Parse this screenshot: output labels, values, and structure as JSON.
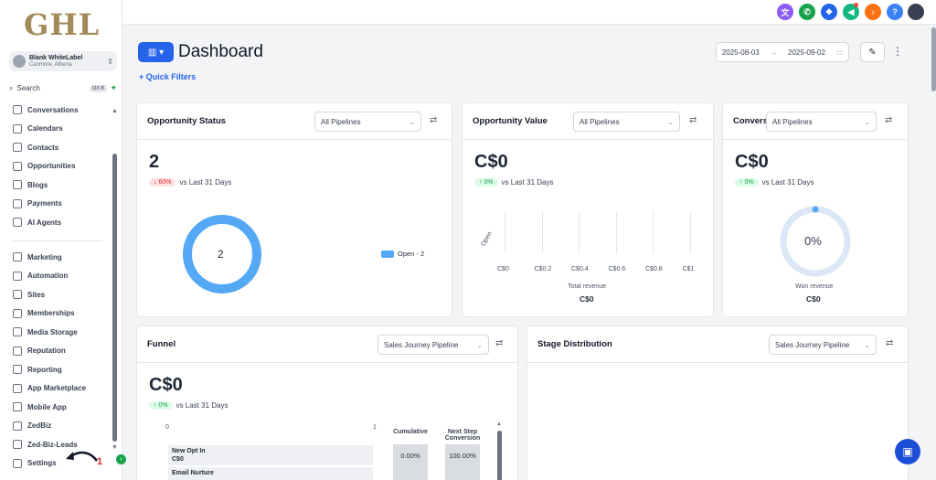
{
  "brand": {
    "logo_text": "GHL"
  },
  "account": {
    "name": "Blank WhiteLabel",
    "location": "Canmore, Alberta"
  },
  "search": {
    "label": "Search",
    "shortcut": "ctrl K"
  },
  "sidebar": {
    "group1": [
      {
        "label": "Conversations",
        "icon": "chat-icon"
      },
      {
        "label": "Calendars",
        "icon": "calendar-icon"
      },
      {
        "label": "Contacts",
        "icon": "contacts-icon"
      },
      {
        "label": "Opportunities",
        "icon": "opportunities-icon"
      },
      {
        "label": "Blogs",
        "icon": "blog-icon"
      },
      {
        "label": "Payments",
        "icon": "payments-icon"
      },
      {
        "label": "AI Agents",
        "icon": "ai-icon"
      }
    ],
    "group2": [
      {
        "label": "Marketing",
        "icon": "send-icon"
      },
      {
        "label": "Automation",
        "icon": "automation-icon"
      },
      {
        "label": "Sites",
        "icon": "sites-icon"
      },
      {
        "label": "Memberships",
        "icon": "memberships-icon"
      },
      {
        "label": "Media Storage",
        "icon": "media-icon"
      },
      {
        "label": "Reputation",
        "icon": "star-icon"
      },
      {
        "label": "Reporting",
        "icon": "reporting-icon"
      },
      {
        "label": "App Marketplace",
        "icon": "apps-icon"
      },
      {
        "label": "Mobile App",
        "icon": "mobile-icon"
      },
      {
        "label": "ZedBiz",
        "icon": "zedbiz-icon"
      },
      {
        "label": "Zed-Biz-Leads",
        "icon": "wrench-icon"
      },
      {
        "label": "Settings",
        "icon": "gear-icon"
      }
    ],
    "annotation_number": "1"
  },
  "topbar": {
    "icons": [
      {
        "name": "translate-icon",
        "color": "#8b5cf6",
        "glyph": "文"
      },
      {
        "name": "phone-icon",
        "color": "#16a34a",
        "glyph": "✆"
      },
      {
        "name": "apps-icon",
        "color": "#2563eb",
        "glyph": "❖"
      },
      {
        "name": "megaphone-icon",
        "color": "#10b981",
        "glyph": "◀"
      },
      {
        "name": "bell-icon",
        "color": "#f97316",
        "glyph": "♪"
      },
      {
        "name": "help-icon",
        "color": "#3b82f6",
        "glyph": "?"
      }
    ]
  },
  "page": {
    "title": "Dashboard",
    "quick_filters": "+  Quick Filters",
    "date_from": "2025-08-03",
    "date_to": "2025-09-02"
  },
  "cards": {
    "opp_status": {
      "title": "Opportunity Status",
      "select": "All Pipelines",
      "value": "2",
      "badge": "↓ 60%",
      "compare": "vs Last 31 Days",
      "donut_center": "2",
      "legend": "Open - 2",
      "open_count": 2
    },
    "opp_value": {
      "title": "Opportunity Value",
      "select": "All Pipelines",
      "value": "C$0",
      "badge": "↑ 0%",
      "compare": "vs Last 31 Days",
      "y_label": "Open",
      "ticks": [
        "C$0",
        "C$0.2",
        "C$0.4",
        "C$0.6",
        "C$0.8",
        "C$1"
      ],
      "caption": "Total revenue",
      "caption_value": "C$0"
    },
    "conversion": {
      "title": "Convers",
      "select": "All Pipelines",
      "value": "C$0",
      "badge": "↑ 0%",
      "compare": "vs Last 31 Days",
      "gauge_text": "0%",
      "gauge_level": 0,
      "caption": "Won revenue",
      "caption_value": "C$0"
    },
    "funnel": {
      "title": "Funnel",
      "select": "Sales Journey Pipeline",
      "value": "C$0",
      "badge": "↑ 0%",
      "compare": "vs Last 31 Days",
      "axis_min": "0",
      "axis_max": "1",
      "col_cumulative": "Cumulative",
      "col_next": "Next Step Conversion",
      "rows": [
        {
          "label": "New Opt In",
          "value": "C$0",
          "cumulative": "0.00%",
          "next": "100.00%"
        },
        {
          "label": "Email Nurture",
          "value": "",
          "cumulative": "",
          "next": ""
        }
      ]
    },
    "stage": {
      "title": "Stage Distribution",
      "select": "Sales Journey Pipeline"
    }
  },
  "colors": {
    "accent": "#2563eb",
    "donut": "#54a8f5",
    "gauge_track": "#dbe7f6"
  }
}
